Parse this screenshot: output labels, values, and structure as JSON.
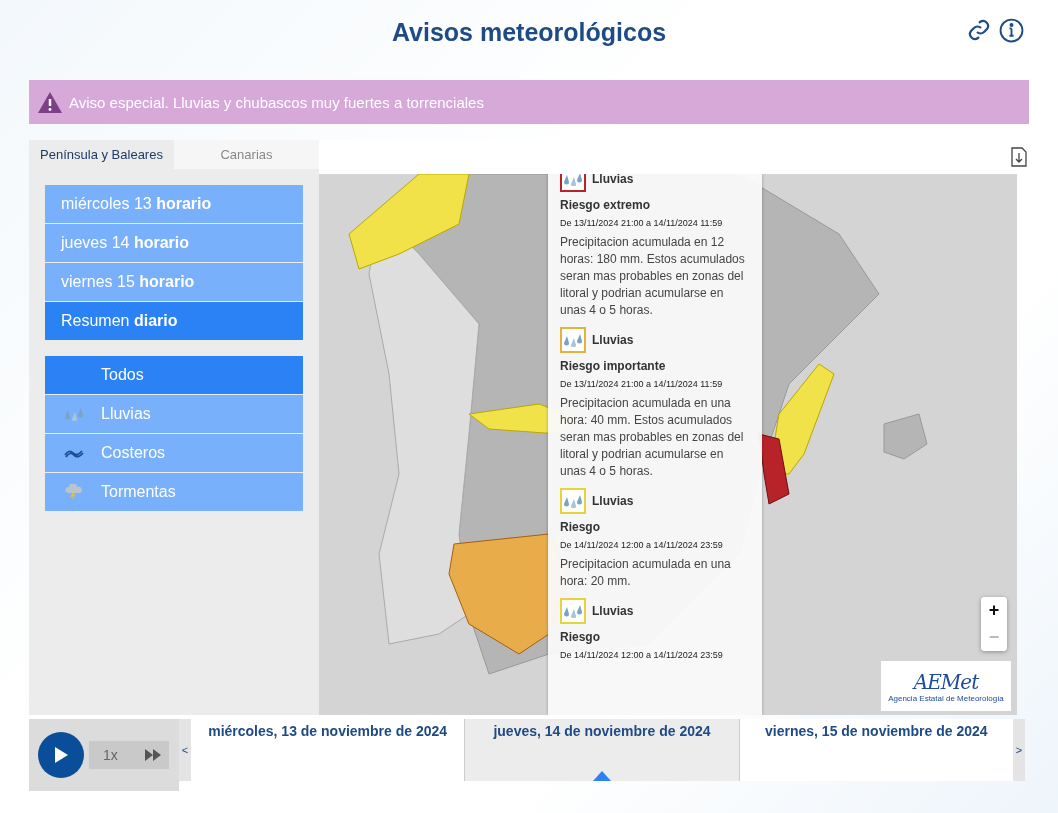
{
  "header": {
    "title": "Avisos meteorológicos"
  },
  "banner": {
    "text": "Aviso especial. Lluvias y chubascos muy fuertes a torrenciales"
  },
  "region_tabs": [
    {
      "label": "Península y Baleares",
      "selected": true
    },
    {
      "label": "Canarias",
      "selected": false
    }
  ],
  "days": [
    {
      "label": "miércoles 13 **horario**",
      "selected": false
    },
    {
      "label": "jueves 14 **horario**",
      "selected": false
    },
    {
      "label": "viernes 15 **horario**",
      "selected": false
    },
    {
      "label": "Resumen **diario**",
      "selected": true
    }
  ],
  "filters": [
    {
      "kind": "all",
      "label": "Todos",
      "selected": true
    },
    {
      "kind": "rain",
      "label": "Lluvias",
      "selected": false
    },
    {
      "kind": "coastal",
      "label": "Costeros",
      "selected": false
    },
    {
      "kind": "storm",
      "label": "Tormentas",
      "selected": false
    }
  ],
  "warnings": [
    {
      "type": "Lluvias",
      "color": "#b8232a",
      "level": "Riesgo extremo",
      "period": "De 13/11/2024 21:00 a 14/11/2024 11:59",
      "description": "Precipitacion acumulada en 12 horas: 180 mm. Estos acumulados seran mas probables en zonas del litoral y podrian acumularse en unas 4 o 5 horas."
    },
    {
      "type": "Lluvias",
      "color": "#e8b03c",
      "level": "Riesgo importante",
      "period": "De 13/11/2024 21:00 a 14/11/2024 11:59",
      "description": "Precipitacion acumulada en una hora: 40 mm. Estos acumulados seran mas probables en zonas del litoral y podrian acumularse en unas 4 o 5 horas."
    },
    {
      "type": "Lluvias",
      "color": "#e6d43a",
      "level": "Riesgo",
      "period": "De 14/11/2024 12:00 a 14/11/2024 23:59",
      "description": "Precipitacion acumulada en una hora: 20 mm."
    },
    {
      "type": "Lluvias",
      "color": "#e6d43a",
      "level": "Riesgo",
      "period": "De 14/11/2024 12:00 a 14/11/2024 23:59"
    }
  ],
  "map_controls": {
    "zoom_in": "+",
    "zoom_out": "−"
  },
  "logo": {
    "mark": "AEMet",
    "caption": "Agencia Estatal de Meteorología"
  },
  "player": {
    "speed": "1x"
  },
  "timeline": {
    "prev": "<",
    "next": ">",
    "dates": [
      {
        "label": "miércoles, 13 de noviembre de 2024",
        "selected": false
      },
      {
        "label": "jueves, 14 de noviembre de 2024",
        "selected": true
      },
      {
        "label": "viernes, 15 de noviembre de 2024",
        "selected": false
      }
    ]
  }
}
